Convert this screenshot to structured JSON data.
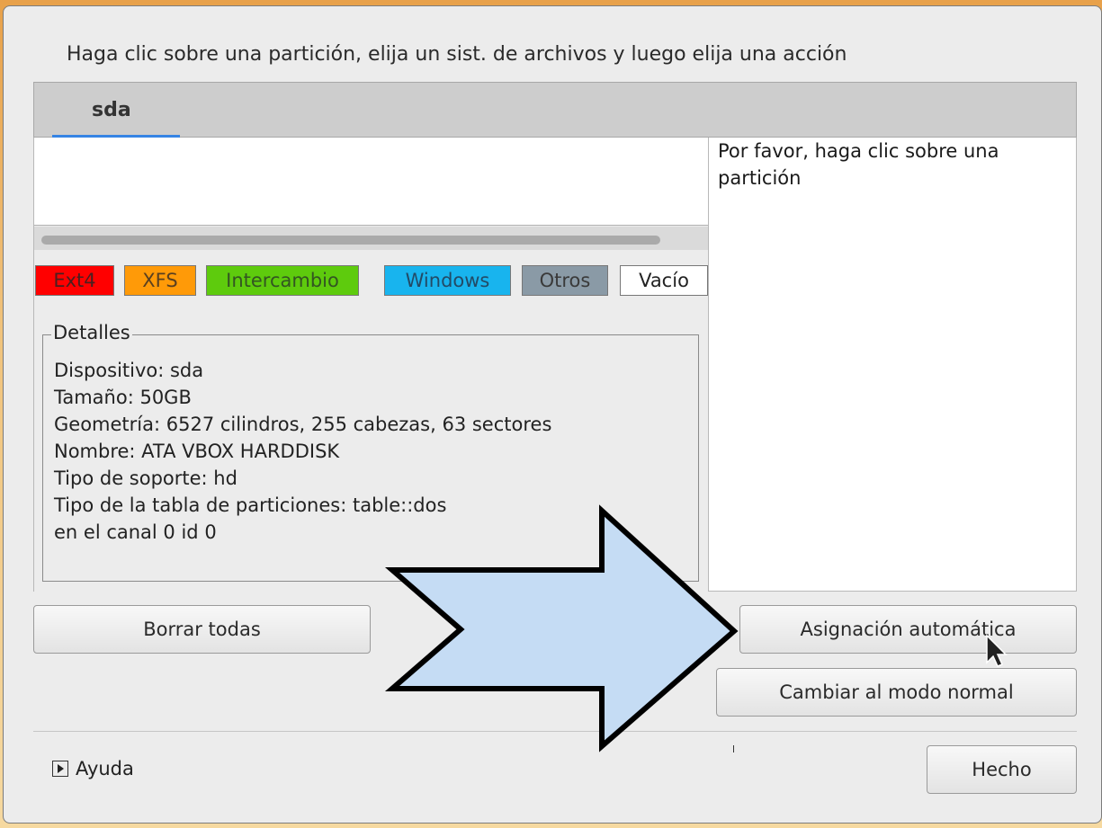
{
  "instruction": "Haga clic sobre una partición, elija un sist. de archivos y luego elija una acción",
  "tabs": [
    {
      "label": "sda"
    }
  ],
  "hint": "Por favor, haga clic sobre una partición",
  "legend": {
    "ext4": "Ext4",
    "xfs": "XFS",
    "swap": "Intercambio",
    "windows": "Windows",
    "other": "Otros",
    "empty": "Vacío"
  },
  "details": {
    "title": "Detalles",
    "lines": [
      "Dispositivo: sda",
      "Tamaño: 50GB",
      "Geometría: 6527 cilindros, 255 cabezas, 63 sectores",
      "Nombre: ATA VBOX HARDDISK",
      "Tipo de soporte: hd",
      "Tipo de la tabla de particiones: table::dos",
      "en el canal 0 id 0"
    ]
  },
  "buttons": {
    "clear_all": "Borrar todas",
    "auto_allocate": "Asignación automática",
    "switch_mode": "Cambiar al modo normal",
    "done": "Hecho"
  },
  "help": {
    "label": "Ayuda"
  },
  "colors": {
    "ext4": "#ff0000",
    "xfs": "#ff9a08",
    "swap": "#5ecb0d",
    "windows": "#18b4ee",
    "other": "#8a9aa6",
    "empty": "#ffffff",
    "tab_accent": "#3584e4",
    "arrow_fill": "#c5dcf4"
  },
  "icons": {
    "help_toggle": "disclosure-triangle-icon",
    "pointer": "mouse-cursor-icon",
    "overlay": "right-arrow-icon"
  }
}
